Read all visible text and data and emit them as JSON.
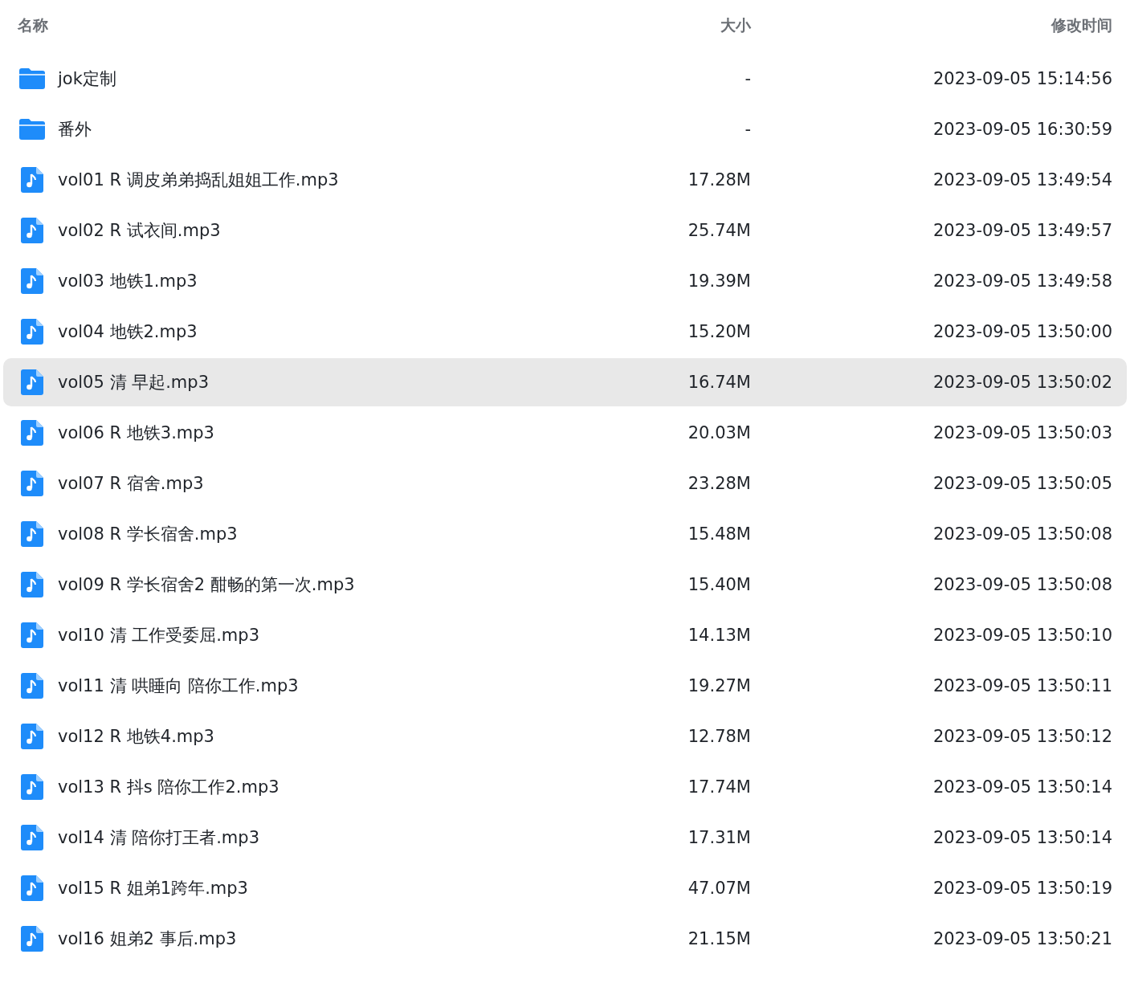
{
  "columns": [
    "名称",
    "大小",
    "修改时间"
  ],
  "rows": [
    {
      "kind": "folder",
      "name": "jok定制",
      "size": "-",
      "modified": "2023-09-05 15:14:56",
      "selected": false
    },
    {
      "kind": "folder",
      "name": "番外",
      "size": "-",
      "modified": "2023-09-05 16:30:59",
      "selected": false
    },
    {
      "kind": "audio",
      "name": "vol01 R 调皮弟弟捣乱姐姐工作.mp3",
      "size": "17.28M",
      "modified": "2023-09-05 13:49:54",
      "selected": false
    },
    {
      "kind": "audio",
      "name": "vol02 R 试衣间.mp3",
      "size": "25.74M",
      "modified": "2023-09-05 13:49:57",
      "selected": false
    },
    {
      "kind": "audio",
      "name": "vol03 地铁1.mp3",
      "size": "19.39M",
      "modified": "2023-09-05 13:49:58",
      "selected": false
    },
    {
      "kind": "audio",
      "name": "vol04 地铁2.mp3",
      "size": "15.20M",
      "modified": "2023-09-05 13:50:00",
      "selected": false
    },
    {
      "kind": "audio",
      "name": "vol05 清 早起.mp3",
      "size": "16.74M",
      "modified": "2023-09-05 13:50:02",
      "selected": true
    },
    {
      "kind": "audio",
      "name": "vol06 R 地铁3.mp3",
      "size": "20.03M",
      "modified": "2023-09-05 13:50:03",
      "selected": false
    },
    {
      "kind": "audio",
      "name": "vol07 R 宿舍.mp3",
      "size": "23.28M",
      "modified": "2023-09-05 13:50:05",
      "selected": false
    },
    {
      "kind": "audio",
      "name": "vol08 R 学长宿舍.mp3",
      "size": "15.48M",
      "modified": "2023-09-05 13:50:08",
      "selected": false
    },
    {
      "kind": "audio",
      "name": "vol09 R 学长宿舍2 酣畅的第一次.mp3",
      "size": "15.40M",
      "modified": "2023-09-05 13:50:08",
      "selected": false
    },
    {
      "kind": "audio",
      "name": "vol10 清 工作受委屈.mp3",
      "size": "14.13M",
      "modified": "2023-09-05 13:50:10",
      "selected": false
    },
    {
      "kind": "audio",
      "name": "vol11 清 哄睡向 陪你工作.mp3",
      "size": "19.27M",
      "modified": "2023-09-05 13:50:11",
      "selected": false
    },
    {
      "kind": "audio",
      "name": "vol12 R 地铁4.mp3",
      "size": "12.78M",
      "modified": "2023-09-05 13:50:12",
      "selected": false
    },
    {
      "kind": "audio",
      "name": "vol13 R 抖s 陪你工作2.mp3",
      "size": "17.74M",
      "modified": "2023-09-05 13:50:14",
      "selected": false
    },
    {
      "kind": "audio",
      "name": "vol14 清 陪你打王者.mp3",
      "size": "17.31M",
      "modified": "2023-09-05 13:50:14",
      "selected": false
    },
    {
      "kind": "audio",
      "name": "vol15 R 姐弟1跨年.mp3",
      "size": "47.07M",
      "modified": "2023-09-05 13:50:19",
      "selected": false
    },
    {
      "kind": "audio",
      "name": "vol16 姐弟2 事后.mp3",
      "size": "21.15M",
      "modified": "2023-09-05 13:50:21",
      "selected": false
    }
  ]
}
